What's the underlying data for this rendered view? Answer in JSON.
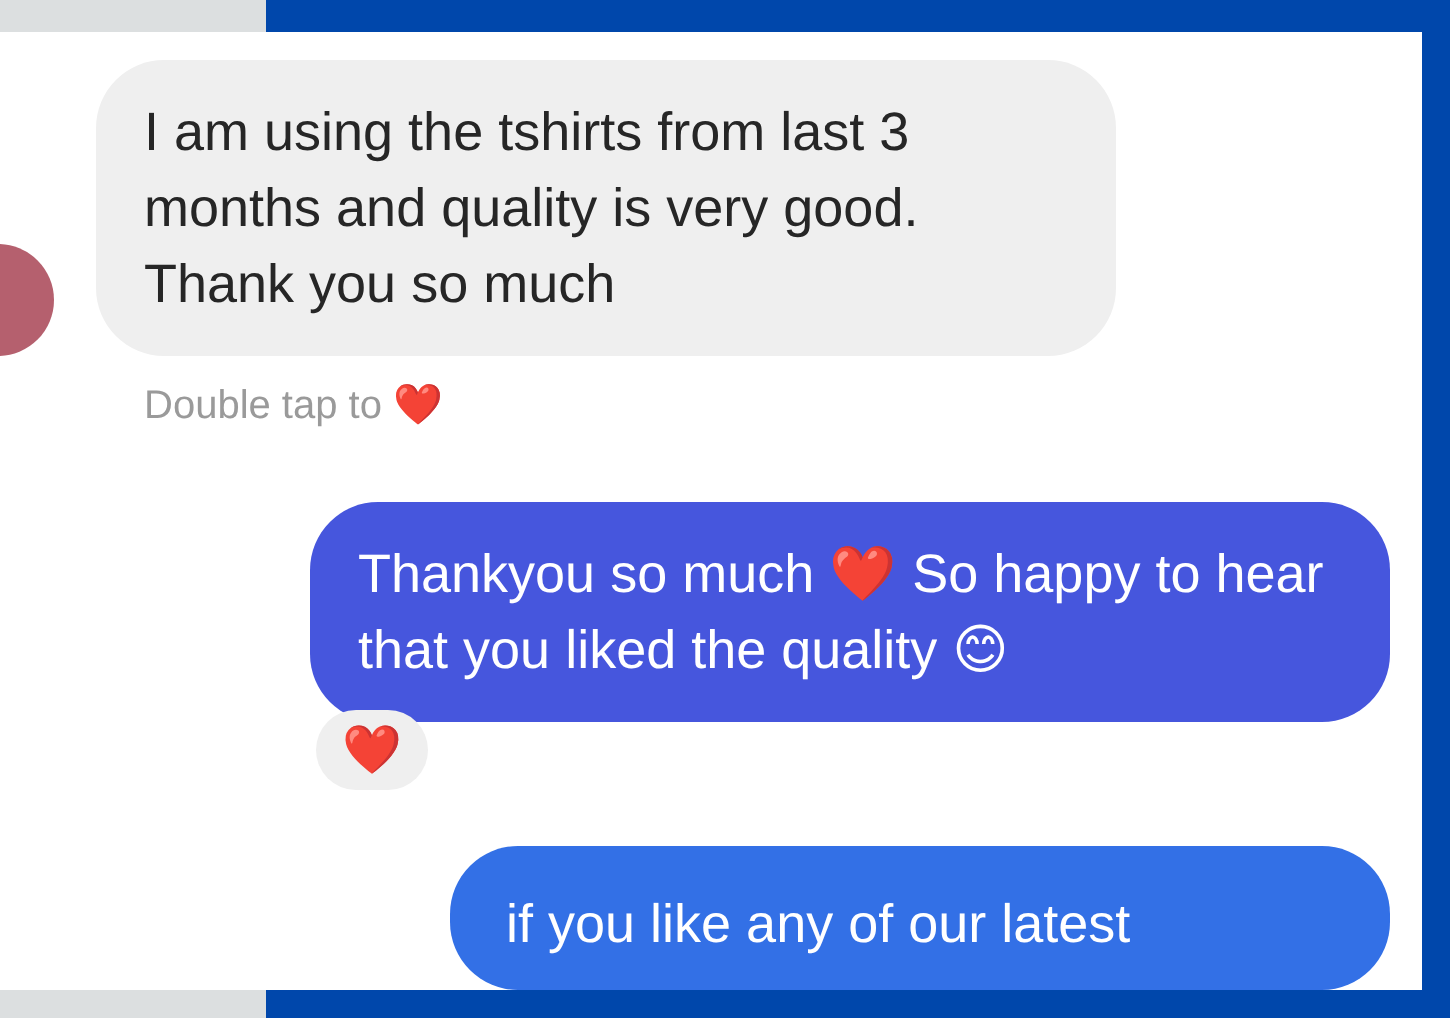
{
  "messages": [
    {
      "kind": "received",
      "text": "I am using the tshirts from last 3 months and quality is very good. Thank you so much",
      "hint": "Double tap to ❤️"
    },
    {
      "kind": "sent",
      "text": "Thankyou so much ❤️ So happy to hear that you liked the quality 😊",
      "reaction": "❤️"
    },
    {
      "kind": "sent",
      "text": "if you like any of our latest"
    }
  ]
}
